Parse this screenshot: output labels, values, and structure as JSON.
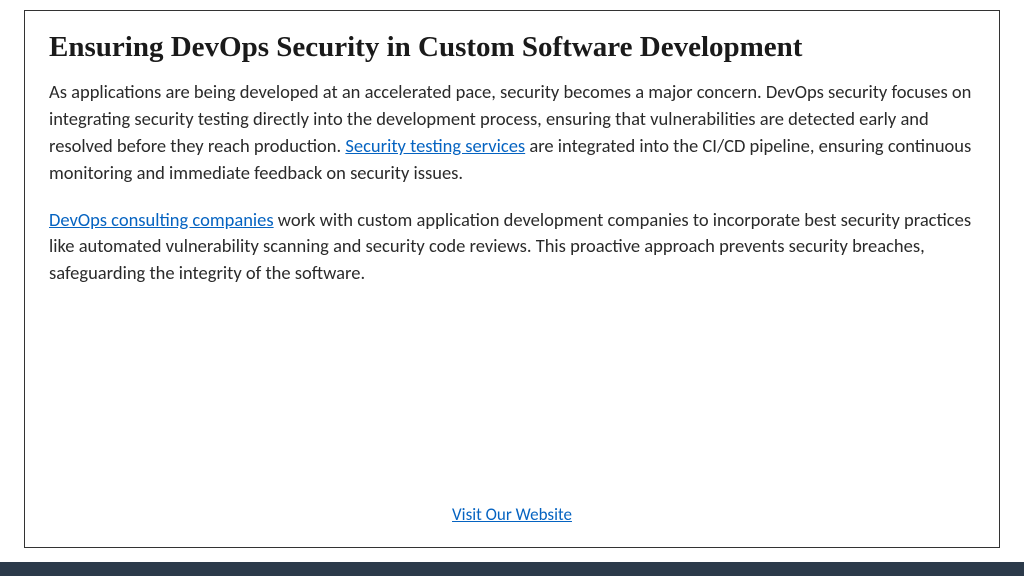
{
  "title": "Ensuring DevOps Security in Custom Software Development",
  "para1": {
    "before_link": "As applications are being developed at an accelerated pace, security becomes a major concern. DevOps security focuses on integrating security testing directly into the development process, ensuring that vulnerabilities are detected early and resolved before they reach production. ",
    "link_text": "Security testing services",
    "after_link": " are integrated into the CI/CD pipeline, ensuring continuous monitoring and immediate feedback on security issues."
  },
  "para2": {
    "link_text": "DevOps consulting companies",
    "after_link": " work with custom application development companies to incorporate best security practices like automated vulnerability scanning and security code reviews. This proactive approach prevents security breaches, safeguarding the integrity of the software."
  },
  "cta": "Visit Our Website"
}
